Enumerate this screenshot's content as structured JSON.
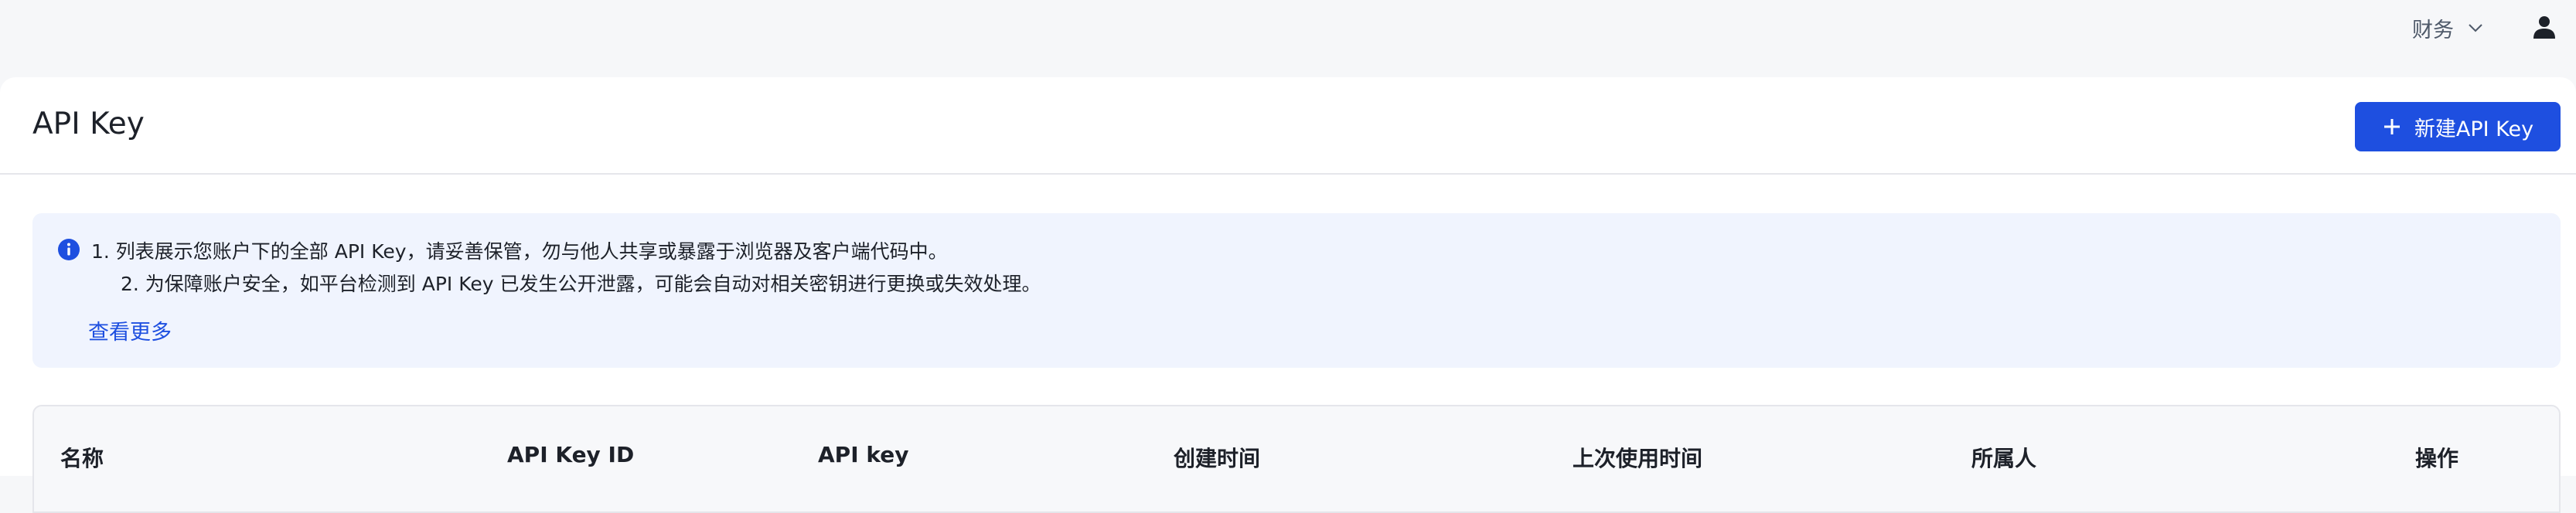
{
  "topbar": {
    "finance_menu": "财务"
  },
  "header": {
    "title": "API Key",
    "new_button_label": "新建API Key"
  },
  "notice": {
    "line1": "1. 列表展示您账户下的全部 API Key，请妥善保管，勿与他人共享或暴露于浏览器及客户端代码中。",
    "line2": "2. 为保障账户安全，如平台检测到 API Key 已发生公开泄露，可能会自动对相关密钥进行更换或失效处理。",
    "more_link": "查看更多"
  },
  "table": {
    "columns": [
      "名称",
      "API Key ID",
      "API key",
      "创建时间",
      "上次使用时间",
      "所属人",
      "操作"
    ]
  },
  "colors": {
    "accent": "#1e4fe0",
    "notice_bg": "#f0f4fe",
    "page_bg": "#f6f7f9"
  }
}
